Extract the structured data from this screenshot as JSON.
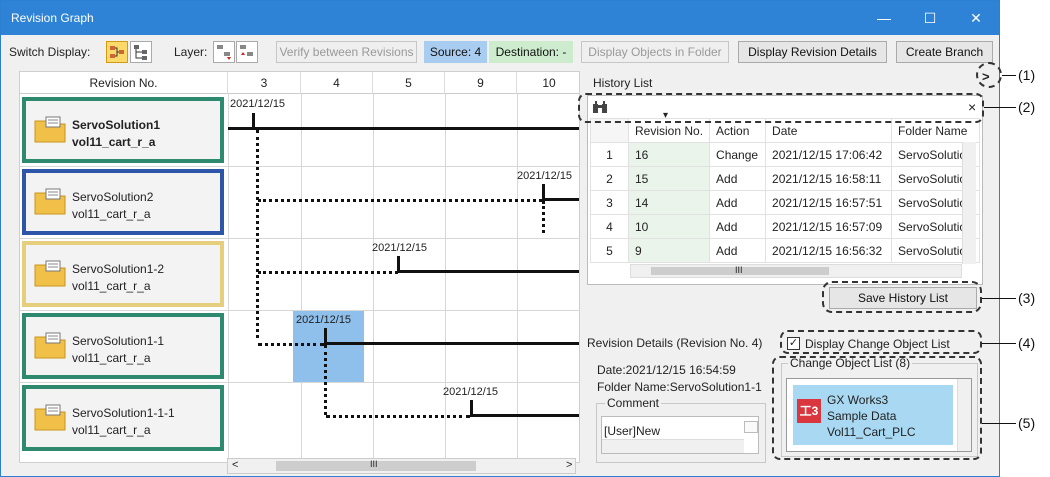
{
  "window": {
    "title": "Revision Graph",
    "minimize": "—",
    "maximize": "☐",
    "close": "✕"
  },
  "toolbar": {
    "switch_display_label": "Switch Display:",
    "layer_label": "Layer:",
    "verify": "Verify between Revisions",
    "source": "Source: 4",
    "destination": "Destination: -",
    "display_objects": "Display Objects in Folder",
    "display_details": "Display Revision Details",
    "create_branch": "Create Branch",
    "source_color": "#a9cdf0",
    "destination_color": "#cdeccd"
  },
  "graph": {
    "header_revision": "Revision No.",
    "columns": [
      "3",
      "4",
      "5",
      "9",
      "10"
    ],
    "rows": [
      {
        "name": "ServoSolution1",
        "sub": "vol11_cart_r_a",
        "color": "#2e8a6e",
        "bold": true
      },
      {
        "name": "ServoSolution2",
        "sub": "vol11_cart_r_a",
        "color": "#2d56a8",
        "bold": false
      },
      {
        "name": "ServoSolution1-2",
        "sub": "vol11_cart_r_a",
        "color": "#e6cf7c",
        "bold": false
      },
      {
        "name": "ServoSolution1-1",
        "sub": "vol11_cart_r_a",
        "color": "#2e8a6e",
        "bold": false
      },
      {
        "name": "ServoSolution1-1-1",
        "sub": "vol11_cart_r_a",
        "color": "#2e8a6e",
        "bold": false
      }
    ],
    "dates": [
      "2021/12/15",
      "2021/12/15",
      "2021/12/15",
      "2021/12/15",
      "2021/12/15"
    ],
    "scroll_center": "III",
    "scroll_left": "<",
    "scroll_right": ">",
    "selected_color": "#8fc0ec"
  },
  "history": {
    "title": "History List",
    "expand": ">",
    "close": "×",
    "sort_arrow": "▾",
    "headers": [
      "Revision No.",
      "Action",
      "Date",
      "Folder Name"
    ],
    "rows": [
      {
        "idx": "1",
        "rev": "16",
        "action": "Change",
        "date": "2021/12/15 17:06:42",
        "folder": "ServoSolutio."
      },
      {
        "idx": "2",
        "rev": "15",
        "action": "Add",
        "date": "2021/12/15 16:58:11",
        "folder": "ServoSolutio."
      },
      {
        "idx": "3",
        "rev": "14",
        "action": "Add",
        "date": "2021/12/15 16:57:51",
        "folder": "ServoSolutio."
      },
      {
        "idx": "4",
        "rev": "10",
        "action": "Add",
        "date": "2021/12/15 16:57:09",
        "folder": "ServoSolution"
      },
      {
        "idx": "5",
        "rev": "9",
        "action": "Add",
        "date": "2021/12/15 16:56:32",
        "folder": "ServoSolutio."
      }
    ],
    "hscroll": "III",
    "save": "Save History List"
  },
  "details": {
    "title": "Revision Details (Revision No. 4)",
    "date": "Date:2021/12/15 16:54:59",
    "folder": "Folder Name:ServoSolution1-1",
    "comment_label": "Comment",
    "comment": "[User]New",
    "display_change_checkbox": "Display Change Object List",
    "change_list_title": "Change Object List (8)",
    "item_line1": "GX Works3",
    "item_line2": "Sample Data",
    "item_line3": "Vol11_Cart_PLC",
    "item_icon_text": "工3"
  },
  "callouts": [
    "(1)",
    "(2)",
    "(3)",
    "(4)",
    "(5)"
  ]
}
